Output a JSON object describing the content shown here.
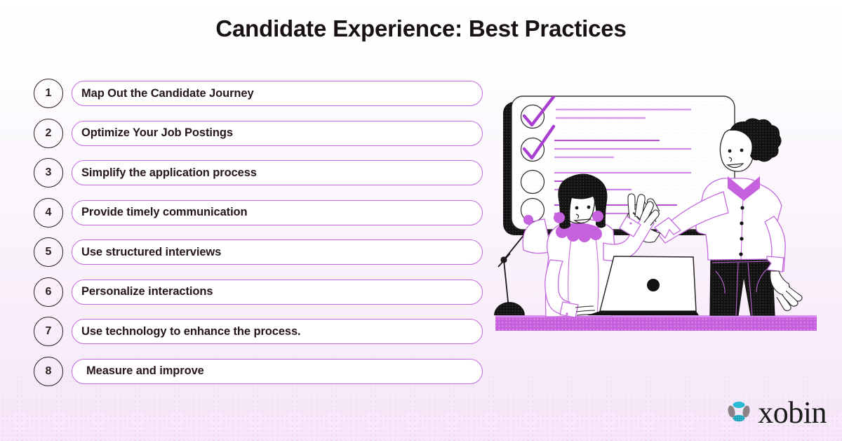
{
  "page": {
    "title": "Candidate Experience: Best Practices",
    "background_top_color": "#ffffff",
    "background_bottom_color": "#f6e7f8",
    "accent_color": "#c368de",
    "accent_bright_color": "#c860dd",
    "text_color": "#271719",
    "ink_color": "#2b1c1e"
  },
  "list": {
    "items": [
      {
        "number": "1",
        "label": "Map Out the Candidate Journey"
      },
      {
        "number": "2",
        "label": "Optimize Your Job Postings"
      },
      {
        "number": "3",
        "label": "Simplify the application process"
      },
      {
        "number": "4",
        "label": "Provide timely communication"
      },
      {
        "number": "5",
        "label": "Use structured interviews"
      },
      {
        "number": "6",
        "label": "Personalize interactions"
      },
      {
        "number": "7",
        "label": "Use technology to enhance the process."
      },
      {
        "number": "8",
        "label": "Measure and improve"
      }
    ]
  },
  "illustration": {
    "name": "whiteboard-checklist-with-two-people",
    "board": {
      "name": "presentation-board",
      "checklist_items": 4,
      "checked_items": 2,
      "checkmark_color": "#a93fd1",
      "text_line_color": "#c96fe2",
      "shadow_color": "#1b1b1b"
    },
    "people": [
      {
        "name": "seated-woman-with-laptop",
        "hair_color": "#211c1c",
        "collar_color": "#c762de",
        "shirt_color": "#ffffff"
      },
      {
        "name": "standing-man-pointing",
        "hair_color": "#211c1c",
        "collar_color": "#c762de",
        "shirt_color": "#ffffff",
        "trousers_color": "#131212"
      }
    ],
    "desk_bar_color": "#c860dd",
    "lamp": {
      "name": "desk-lamp",
      "base_color": "#131212"
    },
    "laptop": {
      "name": "laptop",
      "body_color": "#ffffff",
      "logo_color": "#131212"
    }
  },
  "logo": {
    "wordmark": "xobin",
    "mark_name": "xobin-logo-mark",
    "mark_colors": {
      "top_lobe": "#2bbcd4",
      "bottom_lobe": "#2bbcd4",
      "side_lobes": "#8d8287"
    }
  }
}
